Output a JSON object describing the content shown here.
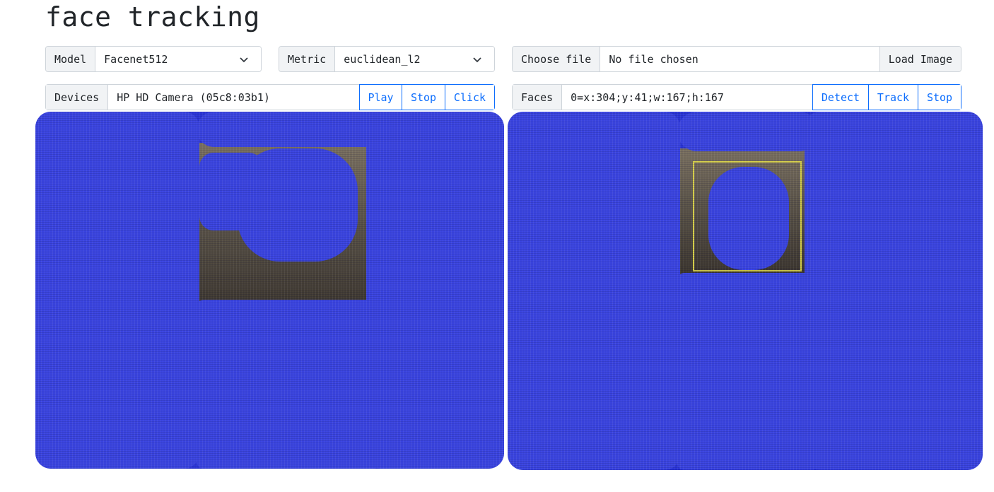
{
  "page": {
    "title": "face tracking"
  },
  "model": {
    "label": "Model",
    "value": "Facenet512"
  },
  "metric": {
    "label": "Metric",
    "value": "euclidean_l2"
  },
  "file": {
    "choose_label": "Choose file",
    "status": "No file chosen",
    "load_label": "Load Image"
  },
  "devices": {
    "label": "Devices",
    "value": "HP HD Camera (05c8:03b1)",
    "buttons": {
      "play": "Play",
      "stop": "Stop",
      "click": "Click"
    }
  },
  "faces": {
    "label": "Faces",
    "value": "0=x:304;y:41;w:167;h:167",
    "buttons": {
      "detect": "Detect",
      "track": "Track",
      "stop": "Stop"
    }
  },
  "colors": {
    "accent": "#0d6efd",
    "overlay": "#2b35d6",
    "face_box": "#d7d04a"
  }
}
